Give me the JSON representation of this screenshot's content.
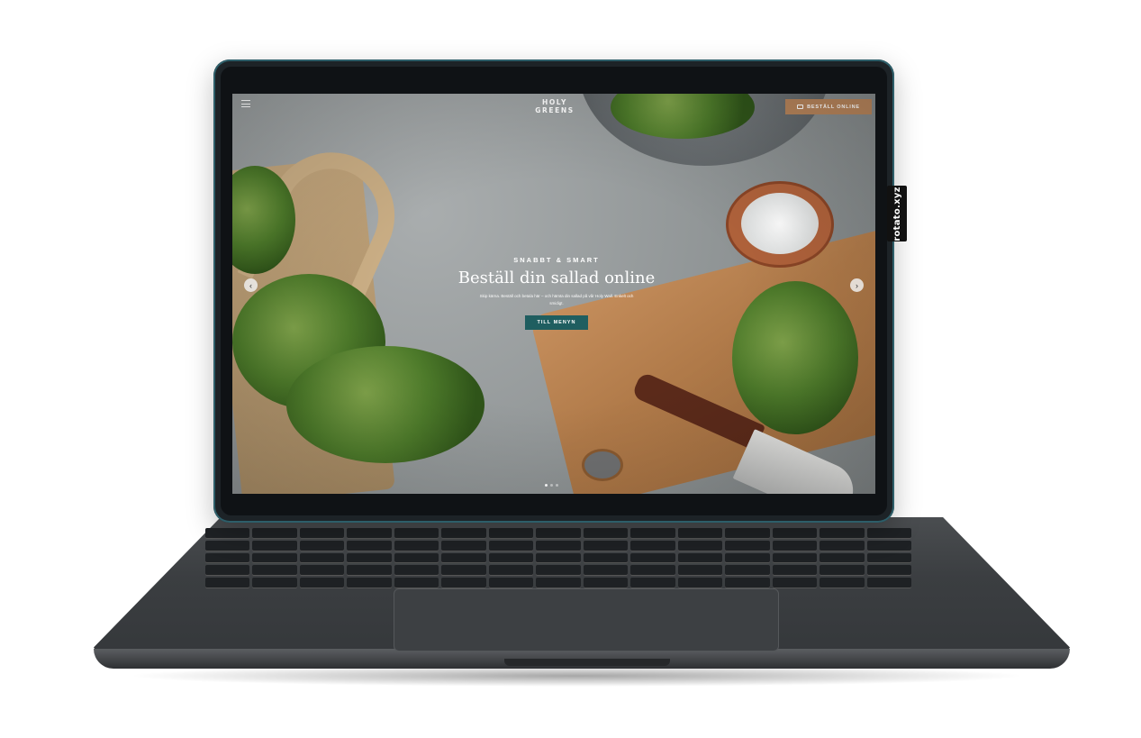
{
  "device": {
    "watermark": "rotato.xyz"
  },
  "site": {
    "logo_line1": "HOLY",
    "logo_line2": "GREENS",
    "order_button": "BESTÄLL ONLINE"
  },
  "hero": {
    "eyebrow": "SNABBT & SMART",
    "headline": "Beställ din sallad online",
    "subtext": "Skip kärna. Beställ och betala här – och hämta din sallad på vår Holy Wall. Enkelt och smidigt.",
    "cta": "TILL MENYN"
  },
  "carousel": {
    "arrow_left": "‹",
    "arrow_right": "›",
    "slides": 3,
    "active_slide": 1
  },
  "colors": {
    "order_button": "#b5835a",
    "cta": "#1f5e60"
  },
  "icons": [
    "hamburger-menu-icon",
    "cart-icon",
    "chevron-left-icon",
    "chevron-right-icon"
  ]
}
